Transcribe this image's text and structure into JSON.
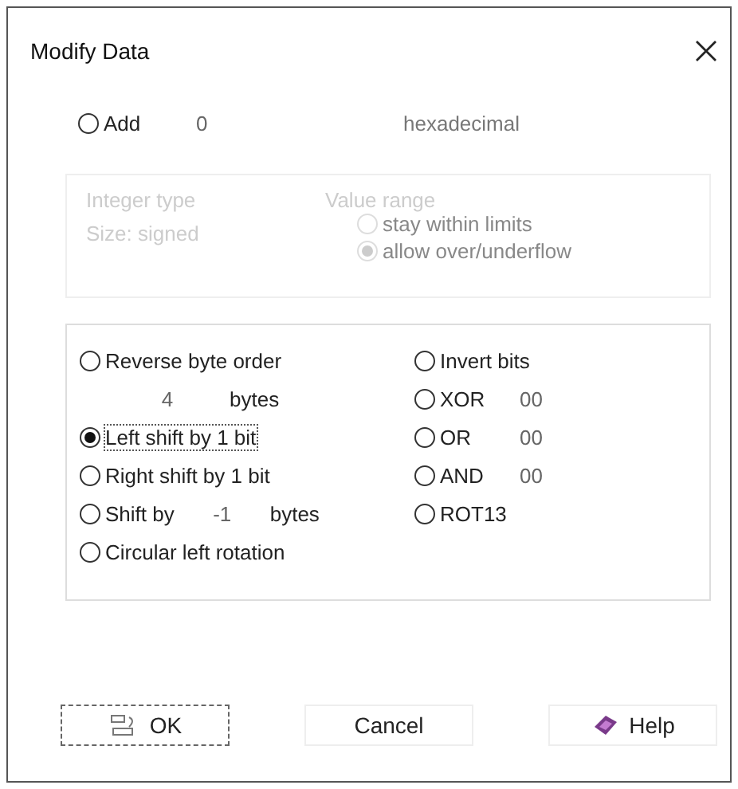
{
  "window": {
    "title": "Modify Data"
  },
  "add": {
    "label": "Add",
    "selected": false,
    "value": "0",
    "base": "hexadecimal"
  },
  "integer_group": {
    "disabled": true,
    "type_label": "Integer type",
    "size_label": "Size: signed",
    "range_label": "Value range",
    "range_options": [
      {
        "label": "stay within limits",
        "selected": false
      },
      {
        "label": "allow over/underflow",
        "selected": true
      }
    ]
  },
  "operations_left": [
    {
      "kind": "option",
      "label": "Reverse byte order",
      "selected": false
    },
    {
      "kind": "field",
      "value": "4",
      "unit": "bytes"
    },
    {
      "kind": "option",
      "label": "Left shift by 1 bit",
      "selected": true
    },
    {
      "kind": "option",
      "label": "Right shift by 1 bit",
      "selected": false
    },
    {
      "kind": "option",
      "label": "Shift by",
      "selected": false,
      "value": "-1",
      "unit": "bytes"
    },
    {
      "kind": "option",
      "label": "Circular left rotation",
      "selected": false
    }
  ],
  "operations_right": [
    {
      "label": "Invert bits",
      "selected": false
    },
    {
      "label": "XOR",
      "selected": false,
      "value": "00"
    },
    {
      "label": "OR",
      "selected": false,
      "value": "00"
    },
    {
      "label": "AND",
      "selected": false,
      "value": "00"
    },
    {
      "label": "ROT13",
      "selected": false
    }
  ],
  "buttons": [
    {
      "kind": "binary",
      "label": "OK",
      "focused": true
    },
    {
      "kind": "plain",
      "label": "Cancel",
      "focused": false
    },
    {
      "kind": "help",
      "label": "Help",
      "focused": false
    }
  ]
}
